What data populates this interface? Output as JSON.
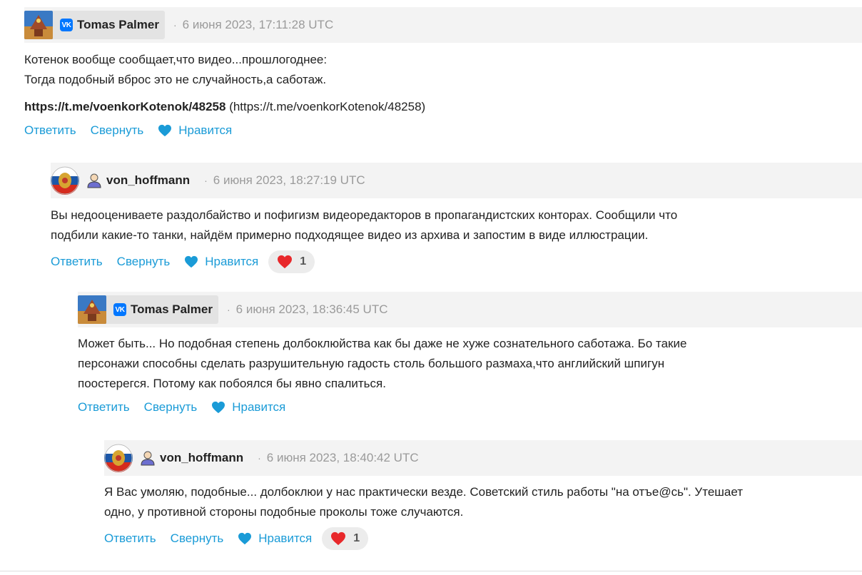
{
  "actions": {
    "reply": "Ответить",
    "collapse": "Свернуть",
    "like": "Нравится"
  },
  "colors": {
    "link": "#1a9bd7",
    "header_bg": "#f3f3f3",
    "heart": "#e8282b",
    "like_heart": "#1a9bd7",
    "vk": "#0077ff"
  },
  "comments": [
    {
      "author": "Tomas Palmer",
      "author_icon": "vk-icon",
      "avatar": "city-coat-of-arms-avatar",
      "separator": "·",
      "date": "6 июня 2023, 17:11:28 UTC",
      "lines": [
        "Котенок вообще сообщает,что видео...прошлогоднее:",
        "Тогда подобный вброс это не случайность,а саботаж."
      ],
      "link_bold": "https://t.me/voenkorKotenok/48258",
      "link_plain": " (https://t.me/voenkorKotenok/48258)"
    },
    {
      "author": "von_hoffmann",
      "author_icon": "user-icon",
      "avatar": "russian-eagle-emblem-avatar",
      "separator": "·",
      "date": "6 июня 2023, 18:27:19 UTC",
      "lines": [
        "Вы недооцениваете раздолбайство и пофигизм видеоредакторов в пропагандистских конторах. Сообщили что",
        "подбили какие-то танки, найдём примерно подходящее видео из архива и запостим в виде иллюстрации."
      ],
      "reaction_count": "1"
    },
    {
      "author": "Tomas Palmer",
      "author_icon": "vk-icon",
      "avatar": "city-coat-of-arms-avatar",
      "separator": "·",
      "date": "6 июня 2023, 18:36:45 UTC",
      "lines": [
        "Может быть... Но подобная степень долбоклюйства как бы даже не хуже сознательного саботажа. Бо такие",
        "персонажи способны сделать разрушительную гадость столь большого размаха,что английский шпигун",
        "поостерегся. Потому как побоялся бы явно спалиться."
      ]
    },
    {
      "author": "von_hoffmann",
      "author_icon": "user-icon",
      "avatar": "russian-eagle-emblem-avatar",
      "separator": "·",
      "date": "6 июня 2023, 18:40:42 UTC",
      "lines": [
        "Я Вас умоляю, подобные... долбоклюи у нас практически везде. Советский стиль работы \"на отъе@сь\". Утешает",
        "одно, у противной стороны подобные проколы тоже случаются."
      ],
      "reaction_count": "1"
    }
  ]
}
